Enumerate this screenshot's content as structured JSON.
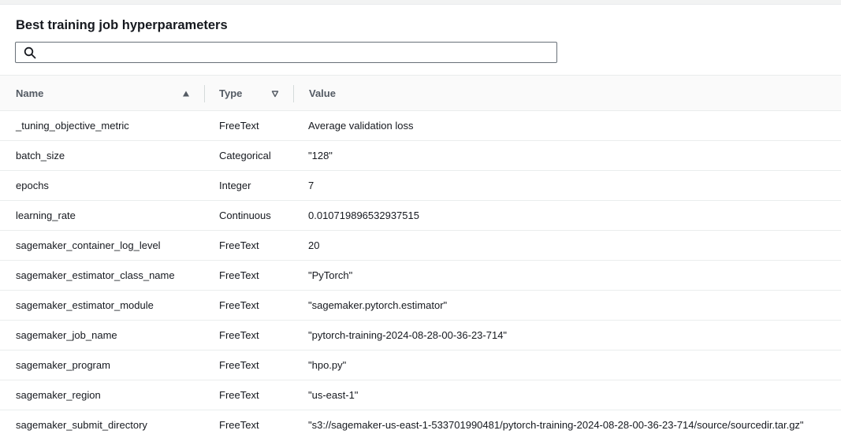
{
  "panel": {
    "title": "Best training job hyperparameters"
  },
  "search": {
    "icon": "search-icon",
    "value": "",
    "placeholder": ""
  },
  "table": {
    "columns": [
      {
        "label": "Name",
        "sort": "ascending"
      },
      {
        "label": "Type",
        "sort": "none"
      },
      {
        "label": "Value",
        "sort": "none"
      }
    ],
    "rows": [
      {
        "name": "_tuning_objective_metric",
        "type": "FreeText",
        "value": "Average validation loss"
      },
      {
        "name": "batch_size",
        "type": "Categorical",
        "value": "\"128\""
      },
      {
        "name": "epochs",
        "type": "Integer",
        "value": "7"
      },
      {
        "name": "learning_rate",
        "type": "Continuous",
        "value": "0.010719896532937515"
      },
      {
        "name": "sagemaker_container_log_level",
        "type": "FreeText",
        "value": "20"
      },
      {
        "name": "sagemaker_estimator_class_name",
        "type": "FreeText",
        "value": "\"PyTorch\""
      },
      {
        "name": "sagemaker_estimator_module",
        "type": "FreeText",
        "value": "\"sagemaker.pytorch.estimator\""
      },
      {
        "name": "sagemaker_job_name",
        "type": "FreeText",
        "value": "\"pytorch-training-2024-08-28-00-36-23-714\""
      },
      {
        "name": "sagemaker_program",
        "type": "FreeText",
        "value": "\"hpo.py\""
      },
      {
        "name": "sagemaker_region",
        "type": "FreeText",
        "value": "\"us-east-1\""
      },
      {
        "name": "sagemaker_submit_directory",
        "type": "FreeText",
        "value": "\"s3://sagemaker-us-east-1-533701990481/pytorch-training-2024-08-28-00-36-23-714/source/sourcedir.tar.gz\""
      }
    ]
  },
  "colors": {
    "header_text": "#545b64",
    "border": "#eaeded",
    "search_border": "#687078",
    "text": "#16191f"
  }
}
